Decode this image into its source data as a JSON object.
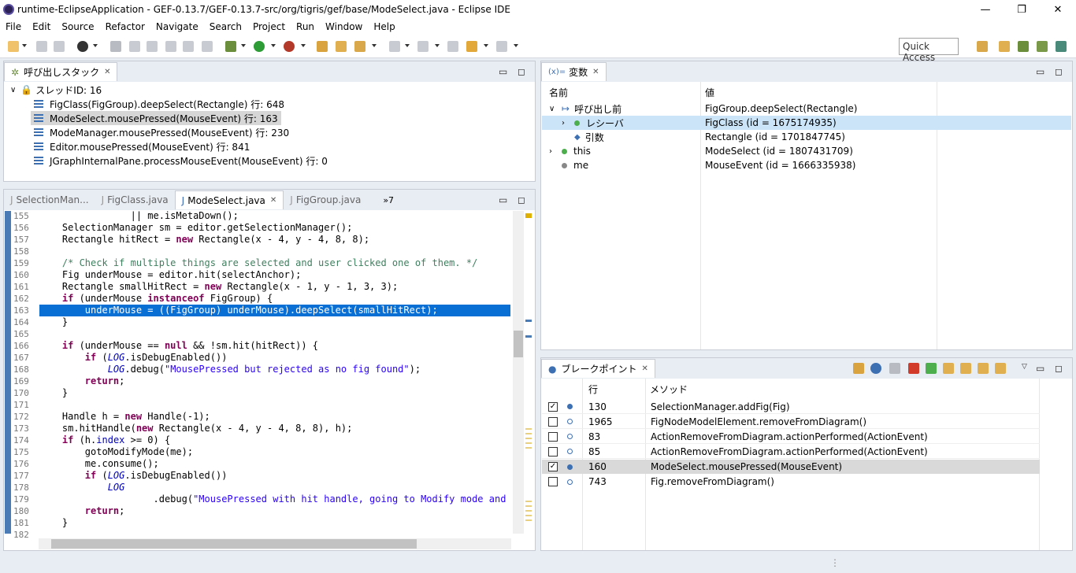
{
  "window": {
    "title": "runtime-EclipseApplication - GEF-0.13.7/GEF-0.13.7-src/org/tigris/gef/base/ModeSelect.java - Eclipse IDE",
    "minimize": "—",
    "restore": "❐",
    "close": "✕"
  },
  "menu": [
    "File",
    "Edit",
    "Source",
    "Refactor",
    "Navigate",
    "Search",
    "Project",
    "Run",
    "Window",
    "Help"
  ],
  "toolbar": {
    "quick_access": "Quick Access"
  },
  "callstack": {
    "tab": "呼び出しスタック",
    "thread": "スレッドID: 16",
    "frames": [
      "FigClass(FigGroup).deepSelect(Rectangle) 行: 648",
      "ModeSelect.mousePressed(MouseEvent) 行: 163",
      "ModeManager.mousePressed(MouseEvent) 行: 230",
      "Editor.mousePressed(MouseEvent) 行: 841",
      "JGraphInternalPane.processMouseEvent(MouseEvent) 行: 0"
    ]
  },
  "editor": {
    "tabs": [
      "SelectionMan...",
      "FigClass.java",
      "ModeSelect.java",
      "FigGroup.java"
    ],
    "overflow": "»7",
    "line_numbers": [
      "155",
      "156",
      "157",
      "158",
      "159",
      "160",
      "161",
      "162",
      "163",
      "164",
      "165",
      "166",
      "167",
      "168",
      "169",
      "170",
      "171",
      "172",
      "173",
      "174",
      "175",
      "176",
      "177",
      "178",
      "179",
      "180",
      "181",
      "182"
    ]
  },
  "variables": {
    "tab": "変数",
    "tab_prefix": "(x)=",
    "col_name": "名前",
    "col_value": "値",
    "rows": [
      {
        "name": "呼び出し前",
        "value": "FigGroup.deepSelect(Rectangle)"
      },
      {
        "name": "レシーバ",
        "value": "FigClass (id = 1675174935)"
      },
      {
        "name": "引数",
        "value": "Rectangle (id = 1701847745)"
      },
      {
        "name": "this",
        "value": "ModeSelect (id = 1807431709)"
      },
      {
        "name": "me",
        "value": "MouseEvent (id = 1666335938)"
      }
    ]
  },
  "breakpoints": {
    "tab": "ブレークポイント",
    "col_line": "行",
    "col_method": "メソッド",
    "rows": [
      {
        "checked": true,
        "line": "130",
        "method": "SelectionManager.addFig(Fig)"
      },
      {
        "checked": false,
        "line": "1965",
        "method": "FigNodeModelElement.removeFromDiagram()"
      },
      {
        "checked": false,
        "line": "83",
        "method": "ActionRemoveFromDiagram.actionPerformed(ActionEvent)"
      },
      {
        "checked": false,
        "line": "85",
        "method": "ActionRemoveFromDiagram.actionPerformed(ActionEvent)"
      },
      {
        "checked": true,
        "line": "160",
        "method": "ModeSelect.mousePressed(MouseEvent)"
      },
      {
        "checked": false,
        "line": "743",
        "method": "Fig.removeFromDiagram()"
      }
    ]
  },
  "colors": {
    "selection": "#0a6fd4",
    "keyword": "#7f0055",
    "string": "#2a00ff",
    "comment": "#3f7f5f"
  }
}
